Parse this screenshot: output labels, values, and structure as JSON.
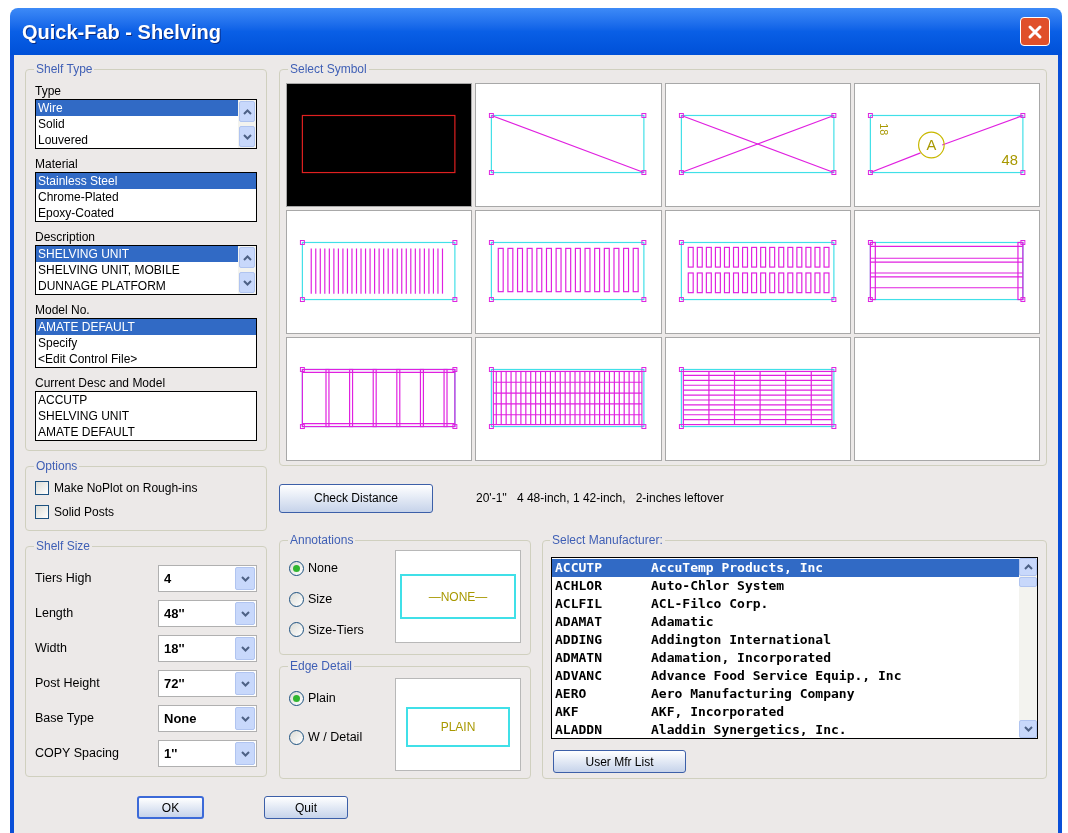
{
  "window": {
    "title": "Quick-Fab - Shelving"
  },
  "shelf_type": {
    "legend": "Shelf Type",
    "lists": [
      {
        "label": "Type",
        "scrollbar": true,
        "items": [
          {
            "text": "Wire",
            "selected": true
          },
          {
            "text": "Solid",
            "selected": false
          },
          {
            "text": "Louvered",
            "selected": false
          }
        ]
      },
      {
        "label": "Material",
        "scrollbar": false,
        "items": [
          {
            "text": "Stainless Steel",
            "selected": true
          },
          {
            "text": "Chrome-Plated",
            "selected": false
          },
          {
            "text": "Epoxy-Coated",
            "selected": false
          }
        ]
      },
      {
        "label": "Description",
        "scrollbar": true,
        "items": [
          {
            "text": "SHELVING UNIT",
            "selected": true
          },
          {
            "text": "SHELVING UNIT, MOBILE",
            "selected": false
          },
          {
            "text": "DUNNAGE PLATFORM",
            "selected": false
          }
        ]
      },
      {
        "label": "Model No.",
        "scrollbar": false,
        "items": [
          {
            "text": "AMATE DEFAULT",
            "selected": true
          },
          {
            "text": "Specify",
            "selected": false
          },
          {
            "text": "<Edit Control File>",
            "selected": false
          }
        ]
      }
    ],
    "current": {
      "label": "Current Desc and Model",
      "lines": [
        "ACCUTP",
        "SHELVING UNIT",
        "AMATE DEFAULT"
      ]
    }
  },
  "options": {
    "legend": "Options",
    "checkboxes": [
      {
        "label": "Make NoPlot on Rough-ins",
        "checked": false
      },
      {
        "label": "Solid Posts",
        "checked": false
      }
    ]
  },
  "shelf_size": {
    "legend": "Shelf Size",
    "fields": [
      {
        "label": "Tiers High",
        "value": "4"
      },
      {
        "label": "Length",
        "value": "48''"
      },
      {
        "label": "Width",
        "value": "18''"
      },
      {
        "label": "Post Height",
        "value": "72''"
      },
      {
        "label": "Base Type",
        "value": "None"
      },
      {
        "label": "COPY Spacing",
        "value": "1''"
      }
    ]
  },
  "select_symbol": {
    "legend": "Select Symbol",
    "symbols": [
      {
        "kind": "outline",
        "selected": true
      },
      {
        "kind": "diagonal",
        "selected": false
      },
      {
        "kind": "cross",
        "selected": false
      },
      {
        "kind": "annotated",
        "selected": false,
        "labels": [
          "18",
          "A",
          "48"
        ]
      },
      {
        "kind": "wire",
        "selected": false
      },
      {
        "kind": "slotted",
        "selected": false
      },
      {
        "kind": "double-slotted",
        "selected": false
      },
      {
        "kind": "rails",
        "selected": false
      },
      {
        "kind": "bays",
        "selected": false
      },
      {
        "kind": "fine-grid",
        "selected": false
      },
      {
        "kind": "rail-grid",
        "selected": false
      },
      {
        "kind": "empty",
        "selected": false
      }
    ]
  },
  "check_distance": {
    "button": "Check Distance",
    "result": "20'-1''   4 48-inch, 1 42-inch,   2-inches leftover"
  },
  "annotations": {
    "legend": "Annotations",
    "options": [
      {
        "label": "None",
        "selected": true
      },
      {
        "label": "Size",
        "selected": false
      },
      {
        "label": "Size-Tiers",
        "selected": false
      }
    ],
    "preview": "—NONE—"
  },
  "edge_detail": {
    "legend": "Edge Detail",
    "options": [
      {
        "label": "Plain",
        "selected": true
      },
      {
        "label": "W / Detail",
        "selected": false
      }
    ],
    "preview": "PLAIN"
  },
  "manufacturer": {
    "legend": "Select Manufacturer:",
    "rows": [
      {
        "code": "ACCUTP",
        "name": "AccuTemp Products, Inc",
        "selected": true
      },
      {
        "code": "ACHLOR",
        "name": "Auto-Chlor System",
        "selected": false
      },
      {
        "code": "ACLFIL",
        "name": "ACL-Filco Corp.",
        "selected": false
      },
      {
        "code": "ADAMAT",
        "name": "Adamatic",
        "selected": false
      },
      {
        "code": "ADDING",
        "name": "Addington International",
        "selected": false
      },
      {
        "code": "ADMATN",
        "name": "Adamation, Incorporated",
        "selected": false
      },
      {
        "code": "ADVANC",
        "name": "Advance Food Service Equip., Inc",
        "selected": false
      },
      {
        "code": "AERO",
        "name": "Aero Manufacturing Company",
        "selected": false
      },
      {
        "code": "AKF",
        "name": "AKF, Incorporated",
        "selected": false
      },
      {
        "code": "ALADDN",
        "name": "Aladdin Synergetics, Inc.",
        "selected": false
      }
    ],
    "button": "User Mfr List"
  },
  "buttons": [
    {
      "label": "OK",
      "default": true
    },
    {
      "label": "Quit",
      "default": false
    }
  ]
}
